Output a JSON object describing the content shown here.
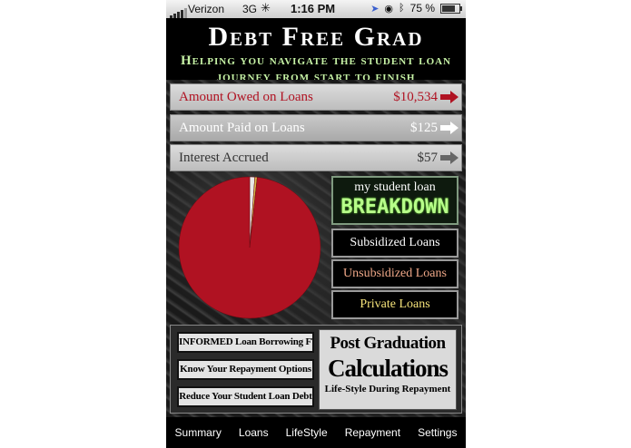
{
  "status_bar": {
    "carrier": "Verizon",
    "network": "3G",
    "time": "1:16 PM",
    "battery": "75 %",
    "battery_level": 0.75
  },
  "header": {
    "title": "Debt Free Grad",
    "subtitle": "Helping you navigate the student loan journey from start to finish"
  },
  "summary": {
    "owed": {
      "label": "Amount Owed on Loans",
      "value": "$10,534",
      "color": "#b01222"
    },
    "paid": {
      "label": "Amount Paid on Loans",
      "value": "$125",
      "color": "#ffffff"
    },
    "interest": {
      "label": "Interest Accrued",
      "value": "$57",
      "color": "#444444"
    }
  },
  "chart_data": {
    "type": "pie",
    "values": [
      10534,
      125,
      57
    ],
    "colors": [
      "#b01222",
      "#e8e8e8",
      "#d8b64a"
    ]
  },
  "breakdown": {
    "top": "my student loan",
    "main": "BREAKDOWN",
    "buttons": {
      "subsidized": "Subsidized Loans",
      "unsubsidized": "Unsubsidized Loans",
      "private": "Private Loans"
    }
  },
  "panel": {
    "informed": "INFORMED Loan Borrowing FTW",
    "know": "Know Your Repayment Options",
    "reduce": "Reduce Your Student Loan Debt",
    "postgrad_top": "Post Graduation",
    "postgrad_main": "Calculations",
    "postgrad_bottom": "Life-Style During Repayment"
  },
  "tabs": [
    "Summary",
    "Loans",
    "LifeStyle",
    "Repayment",
    "Settings"
  ]
}
